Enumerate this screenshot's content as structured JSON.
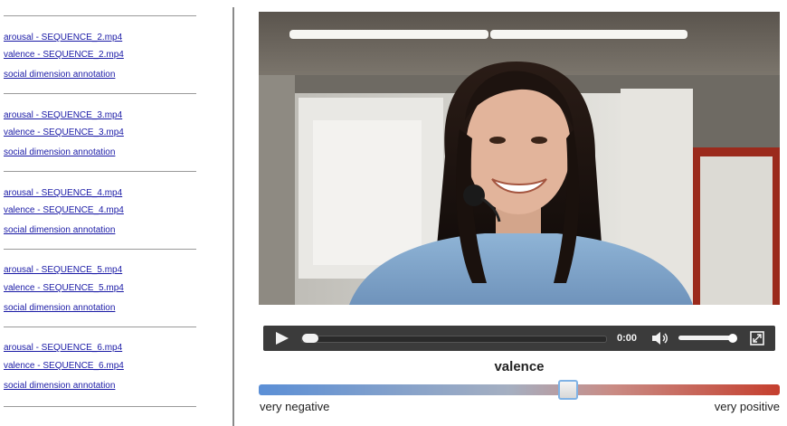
{
  "sidebar": {
    "groups": [
      {
        "arousal": "arousal - SEQUENCE_2.mp4",
        "valence": "valence - SEQUENCE_2.mp4",
        "social": "social dimension annotation"
      },
      {
        "arousal": "arousal - SEQUENCE_3.mp4",
        "valence": "valence - SEQUENCE_3.mp4",
        "social": "social dimension annotation"
      },
      {
        "arousal": "arousal - SEQUENCE_4.mp4",
        "valence": "valence - SEQUENCE_4.mp4",
        "social": "social dimension annotation"
      },
      {
        "arousal": "arousal - SEQUENCE_5.mp4",
        "valence": "valence - SEQUENCE_5.mp4",
        "social": "social dimension annotation"
      },
      {
        "arousal": "arousal - SEQUENCE_6.mp4",
        "valence": "valence - SEQUENCE_6.mp4",
        "social": "social dimension annotation"
      }
    ]
  },
  "player": {
    "time": "0:00",
    "icons": {
      "play": "play-icon",
      "volume": "volume-icon",
      "fullscreen": "fullscreen-icon"
    },
    "progress_fraction": 0.0,
    "volume_fraction": 0.9
  },
  "rating": {
    "title": "valence",
    "left_label": "very negative",
    "right_label": "very positive",
    "value_fraction": 0.6,
    "colors": {
      "negative": "#5b8fd6",
      "positive": "#c53f2e"
    }
  },
  "colors": {
    "link": "#1a1aa6",
    "controls_bg": "#3b3b3b"
  }
}
